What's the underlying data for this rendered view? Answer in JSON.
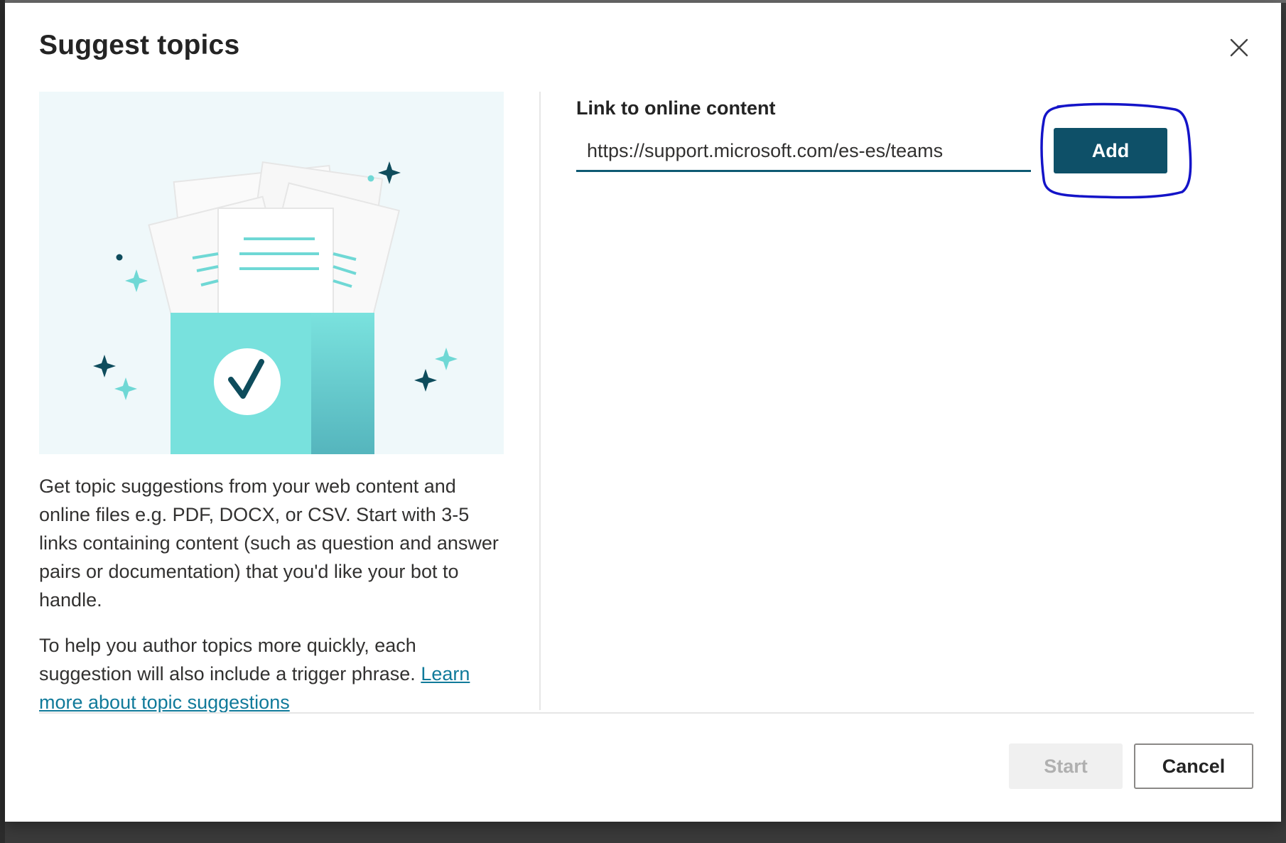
{
  "dialog": {
    "title": "Suggest topics",
    "close_icon": "close-icon"
  },
  "description": {
    "paragraph1": "Get topic suggestions from your web content and online files e.g. PDF, DOCX, or CSV. Start with 3-5 links containing content (such as question and answer pairs or documentation) that you'd like your bot to handle.",
    "paragraph2_text": "To help you author topics more quickly, each suggestion will also include a trigger phrase. ",
    "learn_more_link": "Learn more about topic suggestions"
  },
  "link_field": {
    "label": "Link to online content",
    "value": "https://support.microsoft.com/es-es/teams"
  },
  "buttons": {
    "add": "Add",
    "start": "Start",
    "cancel": "Cancel"
  },
  "colors": {
    "primary": "#0e5068",
    "accent_teal": "#77e0dd",
    "annotation": "#1414c8"
  }
}
